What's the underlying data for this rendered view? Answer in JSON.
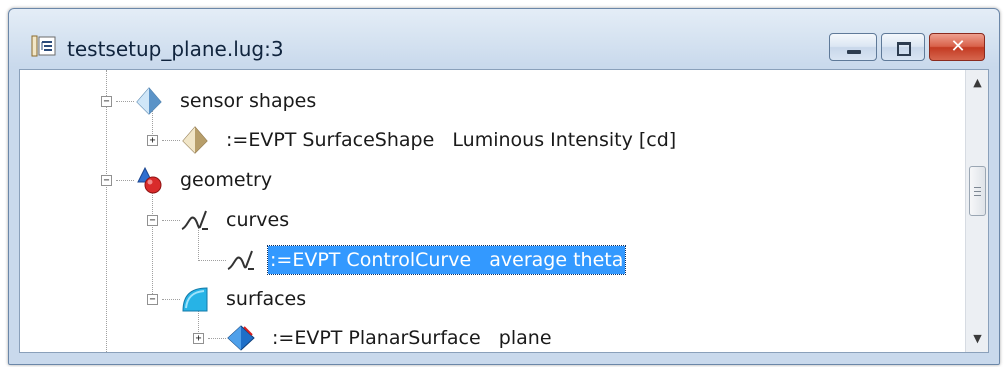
{
  "window": {
    "title": "testsetup_plane.lug:3",
    "title_icon": "file-tree-icon",
    "controls": {
      "minimize": "minimize-icon",
      "maximize": "maximize-icon",
      "close": "close-icon",
      "close_glyph": "✕"
    }
  },
  "tree": {
    "nodes": [
      {
        "label": "sensor shapes",
        "icon": "sensor-shapes-icon",
        "expander": "−"
      },
      {
        "label": ":=EVPT SurfaceShape   Luminous Intensity [cd]",
        "icon": "surface-shape-icon",
        "expander": "+"
      },
      {
        "label": "geometry",
        "icon": "geometry-icon",
        "expander": "−"
      },
      {
        "label": "curves",
        "icon": "curves-icon",
        "expander": "−"
      },
      {
        "label": ":=EVPT ControlCurve   average theta",
        "icon": "control-curve-icon",
        "selected": true
      },
      {
        "label": "surfaces",
        "icon": "surfaces-icon",
        "expander": "−"
      },
      {
        "label": ":=EVPT PlanarSurface   plane",
        "icon": "planar-surface-icon",
        "expander": "+"
      }
    ]
  },
  "scrollbar": {
    "up": "▲",
    "down": "▼",
    "up_icon": "scroll-up-icon",
    "down_icon": "scroll-down-icon"
  }
}
